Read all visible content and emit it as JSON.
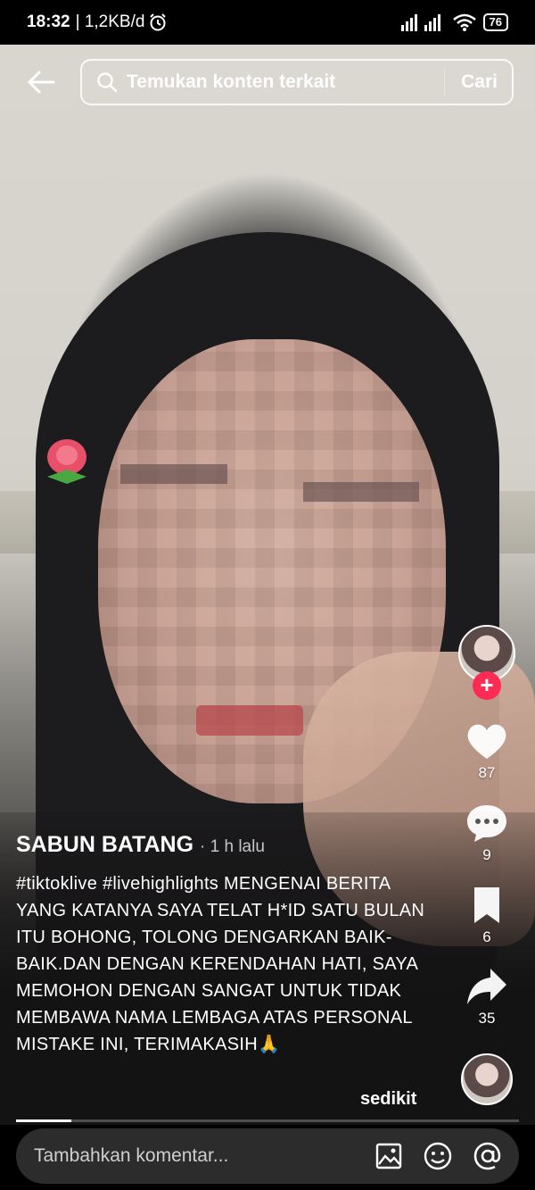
{
  "status_bar": {
    "time": "18:32",
    "network_speed": "| 1,2KB/d",
    "battery": "76"
  },
  "search": {
    "placeholder": "Temukan konten terkait",
    "button": "Cari"
  },
  "rail": {
    "likes": "87",
    "comments": "9",
    "saves": "6",
    "shares": "35"
  },
  "post": {
    "author": "SABUN BATANG",
    "time_ago": "· 1 h lalu",
    "description": "#tiktoklive #livehighlights  MENGENAI BERITA YANG KATANYA SAYA TELAT H*ID SATU BULAN ITU BOHONG, TOLONG DENGARKAN BAIK-BAIK.DAN DENGAN KERENDAHAN HATI, SAYA MEMOHON DENGAN SANGAT UNTUK TIDAK MEMBAWA NAMA LEMBAGA ATAS PERSONAL MISTAKE INI, TERIMAKASIH🙏",
    "less_label": "sedikit"
  },
  "progress": {
    "fraction": 0.11
  },
  "comment_bar": {
    "placeholder": "Tambahkan komentar..."
  },
  "colors": {
    "follow": "#fe2c55",
    "comment_bg": "#2c2c2c"
  },
  "icons": [
    "back-arrow-icon",
    "search-icon",
    "heart-icon",
    "comment-icon",
    "bookmark-icon",
    "share-icon",
    "image-icon",
    "emoji-icon",
    "at-icon"
  ]
}
